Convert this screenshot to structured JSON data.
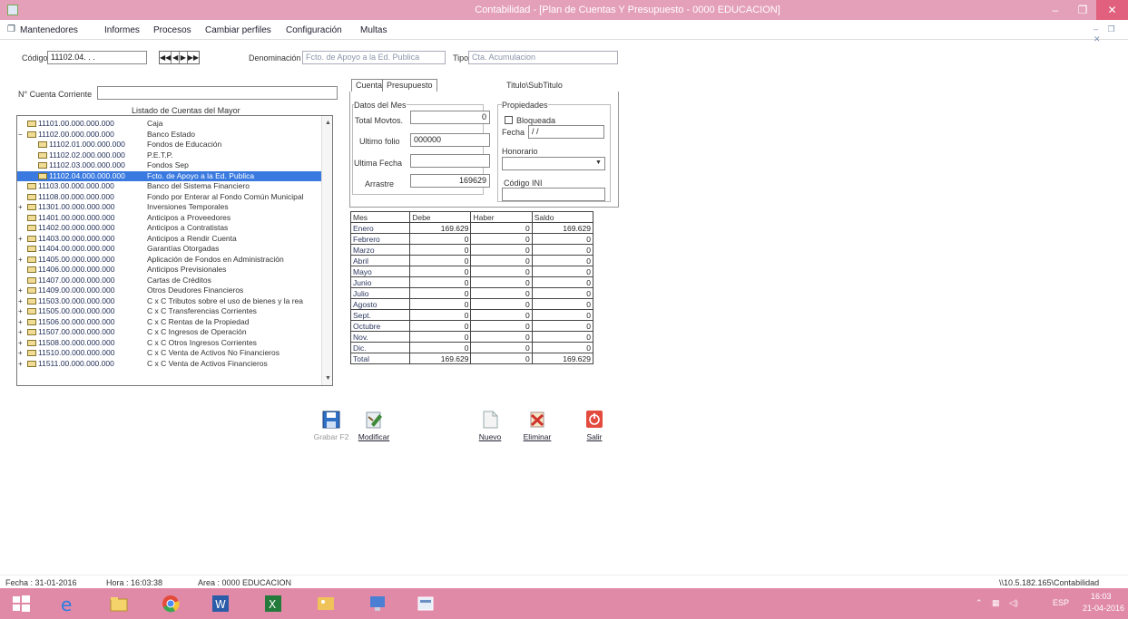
{
  "window": {
    "title": "Contabilidad - [Plan de Cuentas Y Presupuesto  - 0000 EDUCACION]",
    "minimize": "–",
    "maximize": "❐",
    "close": "✕"
  },
  "menu": [
    "Mantenedores",
    "Informes",
    "Procesos",
    "Cambiar perfiles",
    "Configuración",
    "Multas"
  ],
  "mdi_controls": "– ❐ ✕",
  "header": {
    "codigo_label": "Código",
    "codigo_value": "11102.04.   .    .",
    "nav_buttons": [
      "◀◀",
      "◀",
      "▶",
      "▶▶"
    ],
    "denominacion_label": "Denominación",
    "denominacion_value": "Fcto. de Apoyo a la Ed. Publica",
    "tipo_label": "Tipo",
    "tipo_value": "Cta. Acumulacion"
  },
  "cuenta_corriente_label": "N° Cuenta Corriente",
  "cuenta_corriente_value": "",
  "list_title": "Listado de Cuentas del Mayor",
  "accounts": [
    {
      "exp": "",
      "indent": 0,
      "code": "11101.00.000.000.000",
      "name": "Caja"
    },
    {
      "exp": "−",
      "indent": 0,
      "code": "11102.00.000.000.000",
      "name": "Banco Estado"
    },
    {
      "exp": "",
      "indent": 1,
      "code": "11102.01.000.000.000",
      "name": "Fondos de Educación"
    },
    {
      "exp": "",
      "indent": 1,
      "code": "11102.02.000.000.000",
      "name": "P.E.T.P."
    },
    {
      "exp": "",
      "indent": 1,
      "code": "11102.03.000.000.000",
      "name": "Fondos Sep"
    },
    {
      "exp": "",
      "indent": 1,
      "code": "11102.04.000.000.000",
      "name": "Fcto. de Apoyo a la Ed. Publica",
      "selected": true
    },
    {
      "exp": "",
      "indent": 0,
      "code": "11103.00.000.000.000",
      "name": "Banco del Sistema Financiero"
    },
    {
      "exp": "",
      "indent": 0,
      "code": "11108.00.000.000.000",
      "name": "Fondo por Enterar al Fondo Común Municipal"
    },
    {
      "exp": "+",
      "indent": 0,
      "code": "11301.00.000.000.000",
      "name": "Inversiones Temporales"
    },
    {
      "exp": "",
      "indent": 0,
      "code": "11401.00.000.000.000",
      "name": "Anticipos a Proveedores"
    },
    {
      "exp": "",
      "indent": 0,
      "code": "11402.00.000.000.000",
      "name": "Anticipos a Contratistas"
    },
    {
      "exp": "+",
      "indent": 0,
      "code": "11403.00.000.000.000",
      "name": "Anticipos a Rendir Cuenta"
    },
    {
      "exp": "",
      "indent": 0,
      "code": "11404.00.000.000.000",
      "name": "Garantías Otorgadas"
    },
    {
      "exp": "+",
      "indent": 0,
      "code": "11405.00.000.000.000",
      "name": "Aplicación de Fondos en Administración"
    },
    {
      "exp": "",
      "indent": 0,
      "code": "11406.00.000.000.000",
      "name": "Anticipos Previsionales"
    },
    {
      "exp": "",
      "indent": 0,
      "code": "11407.00.000.000.000",
      "name": "Cartas de Créditos"
    },
    {
      "exp": "+",
      "indent": 0,
      "code": "11409.00.000.000.000",
      "name": "Otros Deudores Financieros"
    },
    {
      "exp": "+",
      "indent": 0,
      "code": "11503.00.000.000.000",
      "name": "C x C Tributos sobre el uso de bienes y la rea"
    },
    {
      "exp": "+",
      "indent": 0,
      "code": "11505.00.000.000.000",
      "name": "C x C Transferencias Corrientes"
    },
    {
      "exp": "+",
      "indent": 0,
      "code": "11506.00.000.000.000",
      "name": "C x C Rentas de la Propiedad"
    },
    {
      "exp": "+",
      "indent": 0,
      "code": "11507.00.000.000.000",
      "name": "C x C Ingresos de Operación"
    },
    {
      "exp": "+",
      "indent": 0,
      "code": "11508.00.000.000.000",
      "name": "C x C Otros Ingresos Corrientes"
    },
    {
      "exp": "+",
      "indent": 0,
      "code": "11510.00.000.000.000",
      "name": "C x C Venta de Activos No Financieros"
    },
    {
      "exp": "+",
      "indent": 0,
      "code": "11511.00.000.000.000",
      "name": "C x C Venta de Activos Financieros"
    }
  ],
  "tabs": [
    "Cuenta",
    "Presupuesto"
  ],
  "titulo_label": "Titulo\\SubTitulo",
  "datos_mes": {
    "group_label": "Datos del Mes",
    "total_movtos_label": "Total Movtos.",
    "total_movtos_value": "0",
    "ultimo_folio_label": "Ultimo folio",
    "ultimo_folio_value": "000000",
    "ultima_fecha_label": "Ultima Fecha",
    "ultima_fecha_value": "",
    "arrastre_label": "Arrastre",
    "arrastre_value": "169629"
  },
  "propiedades": {
    "group_label": "Propiedades",
    "bloqueada_label": "Bloqueada",
    "fecha_label": "Fecha",
    "fecha_value": "/ /",
    "honorario_label": "Honorario",
    "honorario_value": "",
    "codigo_ini_label": "Código INI",
    "codigo_ini_value": ""
  },
  "table": {
    "headers": [
      "Mes",
      "Debe",
      "Haber",
      "Saldo"
    ],
    "rows": [
      [
        "Enero",
        "169.629",
        "0",
        "169.629"
      ],
      [
        "Febrero",
        "0",
        "0",
        "0"
      ],
      [
        "Marzo",
        "0",
        "0",
        "0"
      ],
      [
        "Abril",
        "0",
        "0",
        "0"
      ],
      [
        "Mayo",
        "0",
        "0",
        "0"
      ],
      [
        "Junio",
        "0",
        "0",
        "0"
      ],
      [
        "Julio",
        "0",
        "0",
        "0"
      ],
      [
        "Agosto",
        "0",
        "0",
        "0"
      ],
      [
        "Sept.",
        "0",
        "0",
        "0"
      ],
      [
        "Octubre",
        "0",
        "0",
        "0"
      ],
      [
        "Nov.",
        "0",
        "0",
        "0"
      ],
      [
        "Dic.",
        "0",
        "0",
        "0"
      ],
      [
        "Total",
        "169.629",
        "0",
        "169.629"
      ]
    ]
  },
  "toolbar": {
    "grabar": "Grabar F2",
    "modificar": "Modificar",
    "nuevo": "Nuevo",
    "eliminar": "Eliminar",
    "salir": "Salir"
  },
  "status": {
    "fecha": "Fecha : 31-01-2016",
    "hora": "Hora : 16:03:38",
    "area": "Area : 0000 EDUCACION",
    "server": "\\\\10.5.182.165\\Contabilidad"
  },
  "tray": {
    "lang": "ESP",
    "time": "16:03",
    "date": "21-04-2016"
  }
}
